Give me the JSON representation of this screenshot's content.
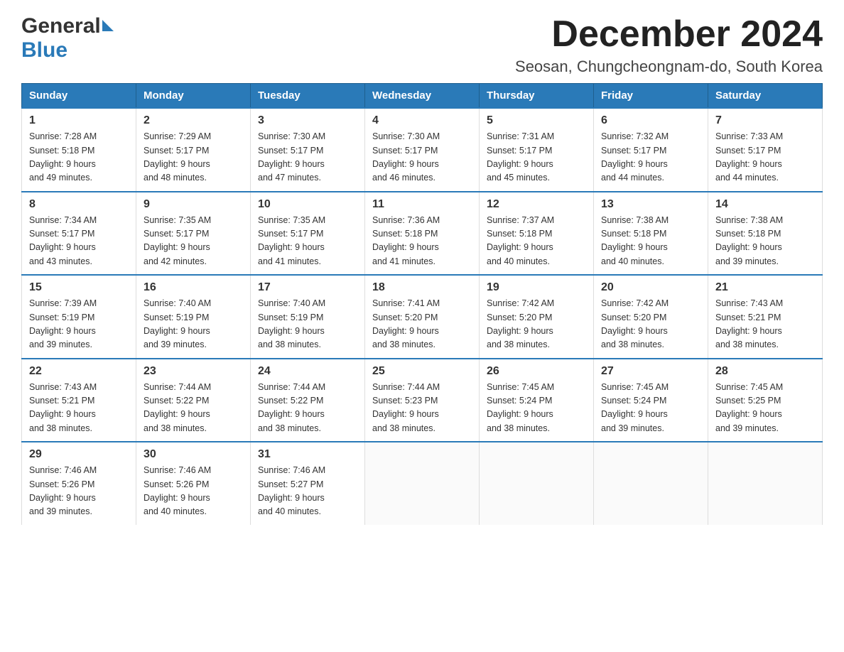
{
  "logo": {
    "general": "General",
    "blue": "Blue"
  },
  "title": "December 2024",
  "subtitle": "Seosan, Chungcheongnam-do, South Korea",
  "days_of_week": [
    "Sunday",
    "Monday",
    "Tuesday",
    "Wednesday",
    "Thursday",
    "Friday",
    "Saturday"
  ],
  "weeks": [
    [
      {
        "day": "1",
        "sunrise": "7:28 AM",
        "sunset": "5:18 PM",
        "daylight": "9 hours and 49 minutes."
      },
      {
        "day": "2",
        "sunrise": "7:29 AM",
        "sunset": "5:17 PM",
        "daylight": "9 hours and 48 minutes."
      },
      {
        "day": "3",
        "sunrise": "7:30 AM",
        "sunset": "5:17 PM",
        "daylight": "9 hours and 47 minutes."
      },
      {
        "day": "4",
        "sunrise": "7:30 AM",
        "sunset": "5:17 PM",
        "daylight": "9 hours and 46 minutes."
      },
      {
        "day": "5",
        "sunrise": "7:31 AM",
        "sunset": "5:17 PM",
        "daylight": "9 hours and 45 minutes."
      },
      {
        "day": "6",
        "sunrise": "7:32 AM",
        "sunset": "5:17 PM",
        "daylight": "9 hours and 44 minutes."
      },
      {
        "day": "7",
        "sunrise": "7:33 AM",
        "sunset": "5:17 PM",
        "daylight": "9 hours and 44 minutes."
      }
    ],
    [
      {
        "day": "8",
        "sunrise": "7:34 AM",
        "sunset": "5:17 PM",
        "daylight": "9 hours and 43 minutes."
      },
      {
        "day": "9",
        "sunrise": "7:35 AM",
        "sunset": "5:17 PM",
        "daylight": "9 hours and 42 minutes."
      },
      {
        "day": "10",
        "sunrise": "7:35 AM",
        "sunset": "5:17 PM",
        "daylight": "9 hours and 41 minutes."
      },
      {
        "day": "11",
        "sunrise": "7:36 AM",
        "sunset": "5:18 PM",
        "daylight": "9 hours and 41 minutes."
      },
      {
        "day": "12",
        "sunrise": "7:37 AM",
        "sunset": "5:18 PM",
        "daylight": "9 hours and 40 minutes."
      },
      {
        "day": "13",
        "sunrise": "7:38 AM",
        "sunset": "5:18 PM",
        "daylight": "9 hours and 40 minutes."
      },
      {
        "day": "14",
        "sunrise": "7:38 AM",
        "sunset": "5:18 PM",
        "daylight": "9 hours and 39 minutes."
      }
    ],
    [
      {
        "day": "15",
        "sunrise": "7:39 AM",
        "sunset": "5:19 PM",
        "daylight": "9 hours and 39 minutes."
      },
      {
        "day": "16",
        "sunrise": "7:40 AM",
        "sunset": "5:19 PM",
        "daylight": "9 hours and 39 minutes."
      },
      {
        "day": "17",
        "sunrise": "7:40 AM",
        "sunset": "5:19 PM",
        "daylight": "9 hours and 38 minutes."
      },
      {
        "day": "18",
        "sunrise": "7:41 AM",
        "sunset": "5:20 PM",
        "daylight": "9 hours and 38 minutes."
      },
      {
        "day": "19",
        "sunrise": "7:42 AM",
        "sunset": "5:20 PM",
        "daylight": "9 hours and 38 minutes."
      },
      {
        "day": "20",
        "sunrise": "7:42 AM",
        "sunset": "5:20 PM",
        "daylight": "9 hours and 38 minutes."
      },
      {
        "day": "21",
        "sunrise": "7:43 AM",
        "sunset": "5:21 PM",
        "daylight": "9 hours and 38 minutes."
      }
    ],
    [
      {
        "day": "22",
        "sunrise": "7:43 AM",
        "sunset": "5:21 PM",
        "daylight": "9 hours and 38 minutes."
      },
      {
        "day": "23",
        "sunrise": "7:44 AM",
        "sunset": "5:22 PM",
        "daylight": "9 hours and 38 minutes."
      },
      {
        "day": "24",
        "sunrise": "7:44 AM",
        "sunset": "5:22 PM",
        "daylight": "9 hours and 38 minutes."
      },
      {
        "day": "25",
        "sunrise": "7:44 AM",
        "sunset": "5:23 PM",
        "daylight": "9 hours and 38 minutes."
      },
      {
        "day": "26",
        "sunrise": "7:45 AM",
        "sunset": "5:24 PM",
        "daylight": "9 hours and 38 minutes."
      },
      {
        "day": "27",
        "sunrise": "7:45 AM",
        "sunset": "5:24 PM",
        "daylight": "9 hours and 39 minutes."
      },
      {
        "day": "28",
        "sunrise": "7:45 AM",
        "sunset": "5:25 PM",
        "daylight": "9 hours and 39 minutes."
      }
    ],
    [
      {
        "day": "29",
        "sunrise": "7:46 AM",
        "sunset": "5:26 PM",
        "daylight": "9 hours and 39 minutes."
      },
      {
        "day": "30",
        "sunrise": "7:46 AM",
        "sunset": "5:26 PM",
        "daylight": "9 hours and 40 minutes."
      },
      {
        "day": "31",
        "sunrise": "7:46 AM",
        "sunset": "5:27 PM",
        "daylight": "9 hours and 40 minutes."
      },
      null,
      null,
      null,
      null
    ]
  ],
  "labels": {
    "sunrise": "Sunrise:",
    "sunset": "Sunset:",
    "daylight": "Daylight:"
  }
}
